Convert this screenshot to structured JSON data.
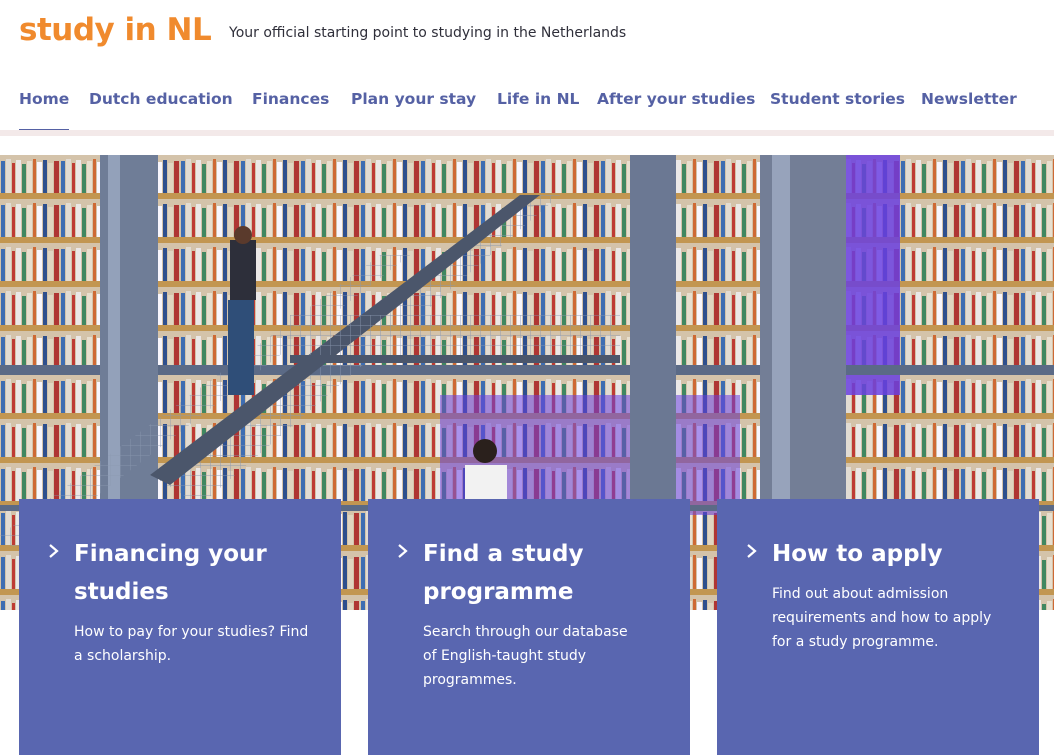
{
  "header": {
    "logo": "study in NL",
    "tagline": "Your official starting point to studying in the Netherlands"
  },
  "nav": {
    "items": [
      {
        "label": "Home",
        "active": true
      },
      {
        "label": "Dutch education"
      },
      {
        "label": "Finances"
      },
      {
        "label": "Plan your stay"
      },
      {
        "label": "Life in NL"
      },
      {
        "label": "After your studies"
      },
      {
        "label": "Student stories"
      },
      {
        "label": "Newsletter"
      }
    ]
  },
  "hero": {
    "image": "library-photo"
  },
  "cards": [
    {
      "title": "Financing your studies",
      "text": "How to pay for your studies? Find a scholarship."
    },
    {
      "title": "Find a study programme",
      "text": "Search through our database of English-taught study programmes."
    },
    {
      "title": "How to apply",
      "text": "Find out about admission requirements and how to apply for a study programme."
    }
  ],
  "colors": {
    "brand_orange": "#f08a2d",
    "nav_blue": "#5561a4",
    "card_blue": "#5966b0",
    "hero_purple": "#6a5bd0"
  }
}
